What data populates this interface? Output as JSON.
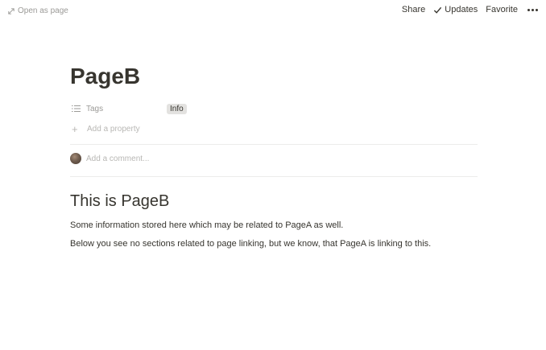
{
  "topbar": {
    "open_as_page": "Open as page",
    "share": "Share",
    "updates": "Updates",
    "favorite": "Favorite"
  },
  "page": {
    "title": "PageB",
    "properties": [
      {
        "name": "Tags",
        "value": "Info"
      }
    ],
    "add_property": "Add a property",
    "comment_placeholder": "Add a comment...",
    "content": {
      "heading": "This is PageB",
      "paragraphs": [
        "Some information stored here which may be related to PageA as well.",
        "Below you see no sections related to page linking, but we know, that PageA is linking to this."
      ]
    }
  }
}
